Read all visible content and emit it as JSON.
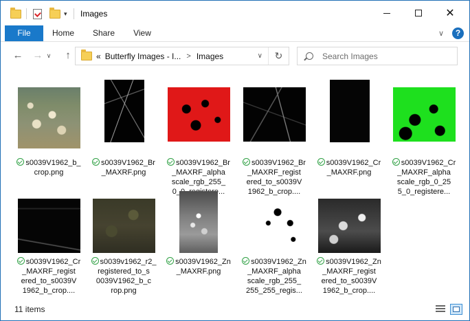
{
  "window": {
    "title": "Images",
    "close_glyph": "✕",
    "qa_arrow": "▾"
  },
  "ribbon": {
    "tabs": [
      "File",
      "Home",
      "Share",
      "View"
    ],
    "help_label": "?",
    "collapse_glyph": "∨"
  },
  "nav": {
    "back_glyph": "←",
    "forward_glyph": "→",
    "up_glyph": "↑",
    "breadcrumb_prefix": "«",
    "breadcrumbs": [
      "Butterfly Images - I...",
      "Images"
    ],
    "crumb_sep": ">",
    "dropdown_glyph": "∨",
    "refresh_glyph": "↻"
  },
  "search": {
    "placeholder": "Search Images"
  },
  "files": [
    {
      "line1": "s0039V1962_b_",
      "line2": "crop.png",
      "line3": "",
      "line4": "",
      "thumb": "painting"
    },
    {
      "line1": "s0039V1962_Br",
      "line2": "_MAXRF.png",
      "line3": "",
      "line4": "",
      "thumb": "branch"
    },
    {
      "line1": "s0039V1962_Br",
      "line2": "_MAXRF_alpha",
      "line3": "scale_rgb_255_",
      "line4": "0_0_registere...",
      "thumb": "red"
    },
    {
      "line1": "s0039V1962_Br",
      "line2": "_MAXRF_regist",
      "line3": "ered_to_s0039V",
      "line4": "1962_b_crop....",
      "thumb": "grey"
    },
    {
      "line1": "s0039V1962_Cr",
      "line2": "_MAXRF.png",
      "line3": "",
      "line4": "",
      "thumb": "black"
    },
    {
      "line1": "s0039V1962_Cr",
      "line2": "_MAXRF_alpha",
      "line3": "scale_rgb_0_25",
      "line4": "5_0_registere...",
      "thumb": "green"
    },
    {
      "line1": "s0039V1962_Cr",
      "line2": "_MAXRF_regist",
      "line3": "ered_to_s0039V",
      "line4": "1962_b_crop....",
      "thumb": "darkbranch"
    },
    {
      "line1": "s0039v1962_r2_",
      "line2": "registered_to_s",
      "line3": "0039V1962_b_c",
      "line4": "rop.png",
      "thumb": "olive"
    },
    {
      "line1": "s0039V1962_Zn",
      "line2": "_MAXRF.png",
      "line3": "",
      "line4": "",
      "thumb": "zn"
    },
    {
      "line1": "s0039V1962_Zn",
      "line2": "_MAXRF_alpha",
      "line3": "scale_rgb_255_",
      "line4": "255_255_regis...",
      "thumb": "whiteblk"
    },
    {
      "line1": "s0039V1962_Zn",
      "line2": "_MAXRF_regist",
      "line3": "ered_to_s0039V",
      "line4": "1962_b_crop....",
      "thumb": "grey2"
    }
  ],
  "status": {
    "item_count": "11 items"
  },
  "colors": {
    "accent": "#1979ca",
    "sync_ok": "#2ea043"
  }
}
